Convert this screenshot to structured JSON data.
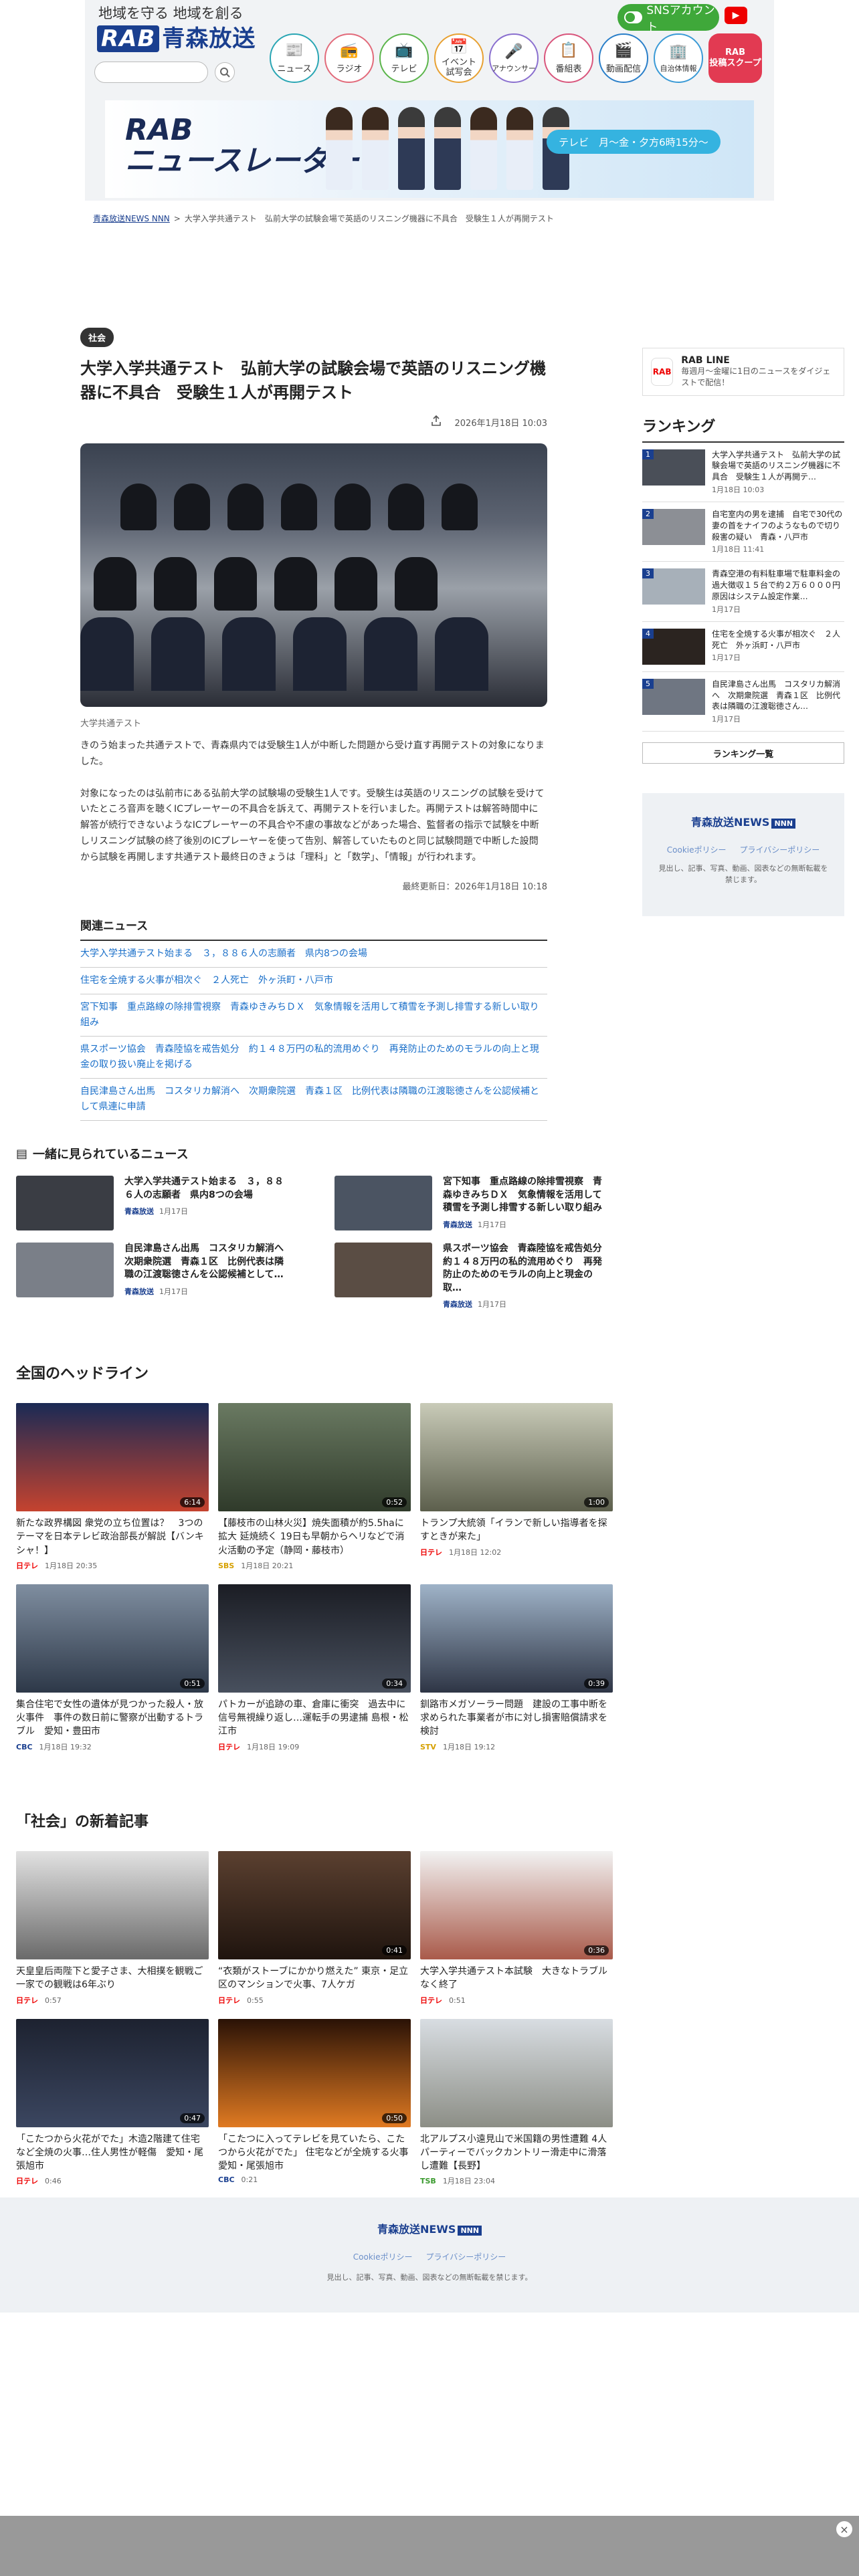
{
  "header": {
    "tagline": "地域を守る 地域を創る",
    "logo_mark": "RAB",
    "logo_text": "青森放送",
    "search_placeholder": "",
    "sns_label": "SNSアカウント",
    "youtube_icon": "youtube-icon",
    "nav": [
      {
        "label": "ニュース",
        "icon": "📰"
      },
      {
        "label": "ラジオ",
        "icon": "📻"
      },
      {
        "label": "テレビ",
        "icon": "📺"
      },
      {
        "label": "イベント\n試写会",
        "icon": "📅"
      },
      {
        "label": "アナウンサー",
        "icon": "🎤"
      },
      {
        "label": "番組表",
        "icon": "📋"
      },
      {
        "label": "動画配信",
        "icon": "🎬"
      },
      {
        "label": "自治体情報",
        "icon": "🏢"
      }
    ],
    "rab_scope": "RAB\n投稿スクープ",
    "banner_title_1": "RAB",
    "banner_title_2": "ニュースレーダー",
    "banner_caption": "テレビ　月〜金・夕方6時15分〜"
  },
  "breadcrumb": {
    "home": "青森放送NEWS NNN",
    "current": "大学入学共通テスト　弘前大学の試験会場で英語のリスニング機器に不具合　受験生１人が再開テスト"
  },
  "article": {
    "category": "社会",
    "title": "大学入学共通テスト　弘前大学の試験会場で英語のリスニング機器に不具合　受験生１人が再開テスト",
    "published": "2026年1月18日 10:03",
    "caption": "大学共通テスト",
    "paragraphs": [
      "きのう始まった共通テストで、青森県内では受験生1人が中断した問題から受け直す再開テストの対象になりました。",
      "対象になったのは弘前市にある弘前大学の試験場の受験生1人です。受験生は英語のリスニングの試験を受けていたところ音声を聴くICプレーヤーの不具合を訴えて、再開テストを行いました。再開テストは解答時間中に解答が続行できないようなICプレーヤーの不具合や不慮の事故などがあった場合、監督者の指示で試験を中断しリスニング試験の終了後別のICプレーヤーを使って告別、解答していたものと同じ試験問題で中断した設問から試験を再開します共通テスト最終日のきょうは「理科」と「数学」、「情報」が行われます。"
    ],
    "updated": "最終更新日：2026年1月18日 10:18"
  },
  "related": {
    "heading": "関連ニュース",
    "items": [
      "大学入学共通テスト始まる　３，８８６人の志願者　県内8つの会場",
      "住宅を全焼する火事が相次ぐ　２人死亡　外ヶ浜町・八戸市",
      "宮下知事　重点路線の除排雪視察　青森ゆきみちＤＸ　気象情報を活用して積雪を予測し排雪する新しい取り組み",
      "県スポーツ協会　青森陸協を戒告処分　約１４８万円の私的流用めぐり　再発防止のためのモラルの向上と現金の取り扱い廃止を掲げる",
      "自民津島さん出馬　コスタリカ解消へ　次期衆院選　青森１区　比例代表は隣職の江渡聡徳さんを公認候補として県連に申請"
    ]
  },
  "sidebar": {
    "line_title": "RAB LINE",
    "line_desc": "毎週月〜金曜に1日のニュースをダイジェストで配信！",
    "ranking_heading": "ランキング",
    "ranking": [
      {
        "title": "大学入学共通テスト　弘前大学の試験会場で英語のリスニング機器に不具合　受験生１人が再開テ…",
        "date": "1月18日 10:03",
        "dur": "1"
      },
      {
        "title": "自宅室内の男を逮捕　自宅で30代の妻の首をナイフのようなもので切り殺害の疑い　青森・八戸市",
        "date": "1月18日 11:41",
        "dur": "2"
      },
      {
        "title": "青森空港の有料駐車場で駐車料金の過大徴収１５台で約２万６０００円　原因はシステム設定作業…",
        "date": "1月17日",
        "dur": "3"
      },
      {
        "title": "住宅を全焼する火事が相次ぐ　２人死亡　外ヶ浜町・八戸市",
        "date": "1月17日",
        "dur": "4"
      },
      {
        "title": "自民津島さん出馬　コスタリカ解消へ　次期衆院選　青森１区　比例代表は隣職の江渡聡徳さん…",
        "date": "1月17日",
        "dur": "5"
      }
    ],
    "ranking_more": "ランキング一覧",
    "brand": "青森放送NEWS",
    "brand_nnn": "NNN",
    "cookie": "Cookieポリシー",
    "privacy": "プライバシーポリシー",
    "note": "見出し、記事、写真、動画、図表などの無断転載を禁じます。"
  },
  "together": {
    "heading": "一緒に見られているニュース",
    "items": [
      {
        "title": "大学入学共通テスト始まる　３，８８６人の志願者　県内8つの会場",
        "src": "青森放送",
        "date": "1月17日"
      },
      {
        "title": "宮下知事　重点路線の除排雪視察　青森ゆきみちＤＸ　気象情報を活用して積雪を予測し排雪する新しい取り組み",
        "src": "青森放送",
        "date": "1月17日"
      },
      {
        "title": "自民津島さん出馬　コスタリカ解消へ　次期衆院選　青森１区　比例代表は隣職の江渡聡徳さんを公認候補として…",
        "src": "青森放送",
        "date": "1月17日"
      },
      {
        "title": "県スポーツ協会　青森陸協を戒告処分　約１４８万円の私的流用めぐり　再発防止のためのモラルの向上と現金の取…",
        "src": "青森放送",
        "date": "1月17日"
      }
    ]
  },
  "national": {
    "heading": "全国のヘッドライン",
    "items": [
      {
        "title": "新たな政界構図 衆党の立ち位置は？　3つのテーマを日本テレビ政治部長が解説【バンキシャ！】",
        "src": "日テレ",
        "date": "1月18日 20:35",
        "dur": "6:14"
      },
      {
        "title": "【藤枝市の山林火災】焼失面積が約5.5haに拡大 延焼続く 19日も早朝からヘリなどで消火活動の予定（静岡・藤枝市）",
        "src": "SBS",
        "date": "1月18日 20:21",
        "dur": "0:52"
      },
      {
        "title": "トランプ大統領「イランで新しい指導者を探すときが来た」",
        "src": "日テレ",
        "date": "1月18日 12:02",
        "dur": "1:00"
      },
      {
        "title": "集合住宅で女性の遺体が見つかった殺人・放火事件　事件の数日前に警察が出動するトラブル　愛知・豊田市",
        "src": "CBC",
        "date": "1月18日 19:32",
        "dur": "0:51"
      },
      {
        "title": "パトカーが追跡の車、倉庫に衝突　過去中に信号無視繰り返し…運転手の男逮捕 島根・松江市",
        "src": "日テレ",
        "date": "1月18日 19:09",
        "dur": "0:34"
      },
      {
        "title": "釧路市メガソーラー問題　建設の工事中断を求められた事業者が市に対し損害賠償請求を検討",
        "src": "STV",
        "date": "1月18日 19:12",
        "dur": "0:39"
      }
    ]
  },
  "society": {
    "heading": "「社会」の新着記事",
    "items": [
      {
        "title": "天皇皇后両陛下と愛子さま、大相撲を観戦ご一家での観戦は6年ぶり",
        "src": "日テレ",
        "date": "0:57",
        "dur": ""
      },
      {
        "title": "“衣類がストーブにかかり燃えた” 東京・足立区のマンションで火事、7人ケガ",
        "src": "日テレ",
        "date": "0:55",
        "dur": "0:41"
      },
      {
        "title": "大学入学共通テスト本試験　大きなトラブルなく終了",
        "src": "日テレ",
        "date": "0:51",
        "dur": "0:36"
      },
      {
        "title": "「こたつから火花がでた」木造2階建て住宅など全焼の火事…住人男性が軽傷　愛知・尾張旭市",
        "src": "日テレ",
        "date": "0:46",
        "dur": "0:47"
      },
      {
        "title": "「こたつに入ってテレビを見ていたら、こたつから火花がでた」 住宅などが全焼する火事　愛知・尾張旭市",
        "src": "CBC",
        "date": "0:21",
        "dur": "0:50"
      },
      {
        "title": "北アルプス小遠見山で米国籍の男性遭難 4人パーティーでバックカントリー滑走中に滑落し遭難【長野】",
        "src": "TSB",
        "date": "1月18日 23:04",
        "dur": ""
      }
    ]
  },
  "footer": {
    "brand": "青森放送NEWS",
    "brand_nnn": "NNN",
    "cookie": "Cookieポリシー",
    "privacy": "プライバシーポリシー",
    "note": "見出し、記事、写真、動画、図表などの無断転載を禁じます。"
  }
}
